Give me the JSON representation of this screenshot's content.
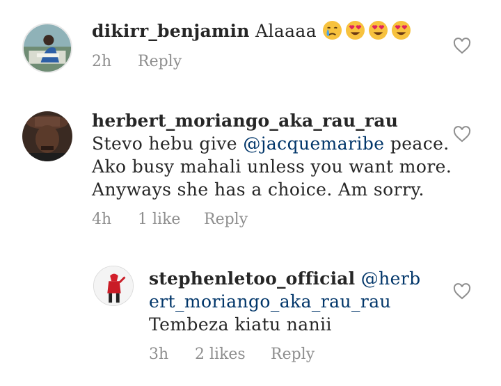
{
  "comments": [
    {
      "username": "dikirr_benjamin",
      "text": "Alaaaa",
      "emojis": [
        "crying-face-emoji",
        "heart-eyes-emoji",
        "heart-eyes-emoji",
        "heart-eyes-emoji"
      ],
      "time": "2h",
      "likes": "",
      "reply_label": "Reply"
    },
    {
      "username": "herbert_moriango_aka_rau_rau",
      "text_before": "Stevo hebu give",
      "mention": "@jacquemaribe",
      "text_after": "peace. Ako busy mahali unless you want more. Anyways she has a choice. Am sorry.",
      "time": "4h",
      "likes": "1 like",
      "reply_label": "Reply"
    },
    {
      "username": "stephenletoo_official",
      "mention": "@herbert_moriango_aka_rau_rau",
      "text": "Tembeza kiatu nanii",
      "time": "3h",
      "likes": "2 likes",
      "reply_label": "Reply"
    }
  ],
  "colors": {
    "text": "#262626",
    "meta": "#8e8e8e",
    "mention": "#003569"
  }
}
